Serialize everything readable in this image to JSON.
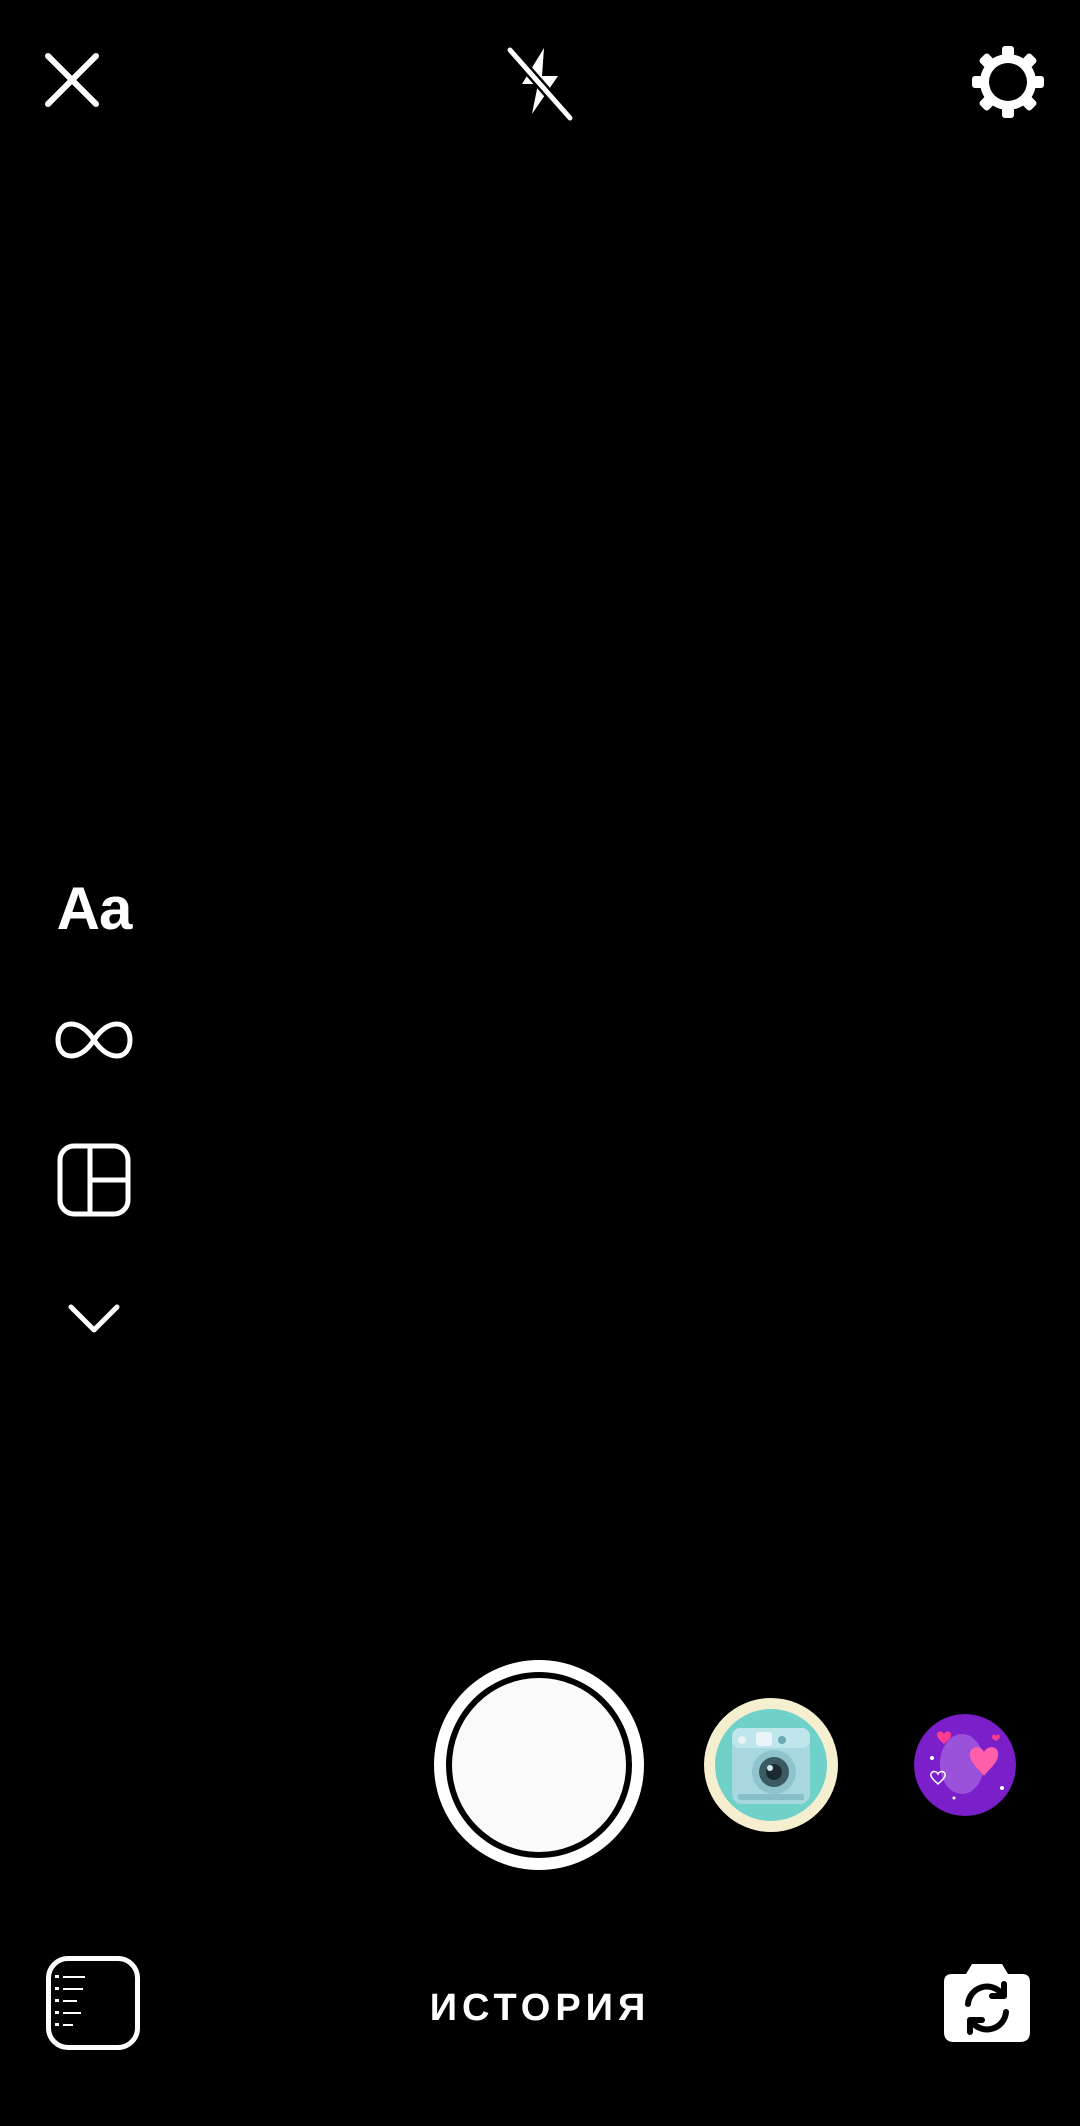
{
  "top_bar": {
    "close_icon": "close-icon",
    "flash_icon": "flash-off-icon",
    "settings_icon": "gear-icon"
  },
  "side_tools": {
    "text_tool_label": "Aa",
    "boomerang_icon": "infinity-icon",
    "layout_icon": "layout-grid-icon",
    "more_icon": "chevron-down-icon"
  },
  "capture": {
    "shutter": "shutter-button",
    "effects": [
      {
        "icon": "instant-camera-effect-icon"
      },
      {
        "icon": "hearts-effect-icon"
      }
    ]
  },
  "bottom_bar": {
    "mode_label": "ИСТОРИЯ",
    "gallery_icon": "gallery-thumbnail",
    "flip_icon": "camera-flip-icon"
  },
  "colors": {
    "background": "#000000",
    "foreground": "#ffffff",
    "effect_ring": "#f6efcf",
    "effect_purple": "#7a1fc9"
  }
}
